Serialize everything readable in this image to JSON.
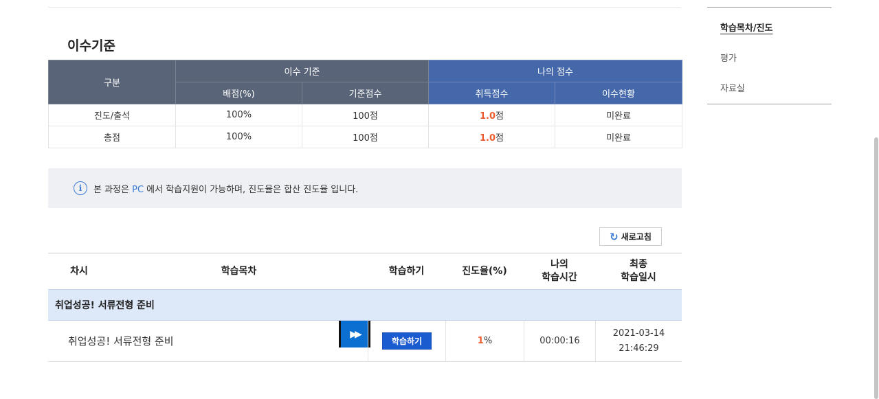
{
  "section_title": "이수기준",
  "criteria": {
    "header_category": "구분",
    "header_group_criteria": "이수 기준",
    "header_group_myscore": "나의 점수",
    "header_weight": "배점(%)",
    "header_base_score": "기준점수",
    "header_earned": "취득점수",
    "header_status": "이수현황",
    "rows": [
      {
        "category": "진도/출석",
        "weight": "100%",
        "base": "100점",
        "earned_num": "1.0",
        "earned_unit": "점",
        "status": "미완료"
      },
      {
        "category": "총점",
        "weight": "100%",
        "base": "100점",
        "earned_num": "1.0",
        "earned_unit": "점",
        "status": "미완료"
      }
    ]
  },
  "notice": {
    "icon": "info-icon",
    "glyph": "i",
    "prefix": "본 과정은 ",
    "highlight": "PC",
    "suffix": " 에서 학습지원이 가능하며, 진도율은 합산 진도율 입니다."
  },
  "refresh": {
    "icon": "refresh-icon",
    "glyph": "↻",
    "label": "새로고침"
  },
  "lesson_table": {
    "headers": {
      "session": "차시",
      "contents": "학습목차",
      "study": "학습하기",
      "progress": "진도율(%)",
      "my_time_1": "나의",
      "my_time_2": "학습시간",
      "last_date_1": "최종",
      "last_date_2": "학습일시"
    },
    "chapter_title": "취업성공! 서류전형 준비",
    "rows": [
      {
        "title": "취업성공! 서류전형 준비",
        "play_icon": "fast-forward-icon",
        "play_glyph": "▶▶",
        "study_button": "학습하기",
        "progress_num": "1",
        "progress_unit": "%",
        "time": "00:00:16",
        "date": "2021-03-14",
        "clock": "21:46:29"
      }
    ]
  },
  "side_nav": {
    "items": [
      {
        "label": "학습목차/진도",
        "active": true
      },
      {
        "label": "평가",
        "active": false
      },
      {
        "label": "자료실",
        "active": false
      }
    ]
  },
  "colors": {
    "header_gray": "#5a6478",
    "header_blue": "#4468aa",
    "accent_orange": "#ee5a2c",
    "accent_blue": "#3d7ad6",
    "chapter_bg": "#dde8f8",
    "button_blue": "#1a5bd0"
  }
}
